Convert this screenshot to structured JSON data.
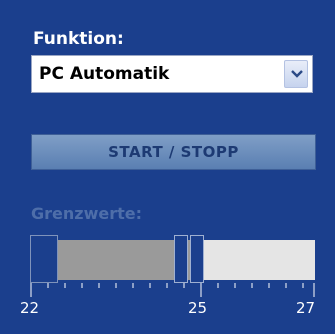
{
  "function_label": "Funktion:",
  "function_select": {
    "value": "PC Automatik",
    "icon": "chevron-down-icon"
  },
  "start_stop_label": "START / STOPP",
  "limits_label": "Grenzwerte:",
  "slider": {
    "min": 22,
    "max": 27,
    "lower_value": 24.7,
    "upper_value": 25,
    "tick_labels": [
      "22",
      "25",
      "27"
    ]
  },
  "colors": {
    "background": "#1b3f8d",
    "range_fill": "#9a9a9a",
    "track_fill": "#e5e5e5",
    "disabled_label": "#4e6ea9"
  }
}
